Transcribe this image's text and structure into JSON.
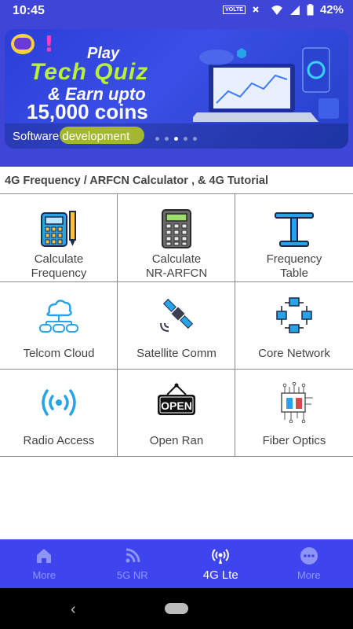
{
  "status_bar": {
    "time": "10:45",
    "volte": "VOLTE",
    "battery": "42%"
  },
  "banner": {
    "play": "Play",
    "tech_quiz": "Tech Quiz",
    "earn": "& Earn upto",
    "coins": "15,000 coins",
    "caption": "Software development",
    "slide_count": 5,
    "active_slide": 3
  },
  "section_title": "4G Frequency / ARFCN Calculator , & 4G Tutorial",
  "grid": [
    {
      "line1": "Calculate",
      "line2": "Frequency",
      "icon": "calculator-pencil-icon"
    },
    {
      "line1": "Calculate",
      "line2": "NR-ARFCN",
      "icon": "calculator-icon"
    },
    {
      "line1": "Frequency",
      "line2": "Table",
      "icon": "table-icon"
    },
    {
      "line1": "Telcom Cloud",
      "line2": "",
      "icon": "cloud-network-icon"
    },
    {
      "line1": "Satellite Comm",
      "line2": "",
      "icon": "satellite-icon"
    },
    {
      "line1": "Core Network",
      "line2": "",
      "icon": "network-nodes-icon"
    },
    {
      "line1": "Radio Access",
      "line2": "",
      "icon": "radio-waves-icon"
    },
    {
      "line1": "Open Ran",
      "line2": "",
      "icon": "open-sign-icon",
      "sign_text": "OPEN"
    },
    {
      "line1": "Fiber Optics",
      "line2": "",
      "icon": "circuit-board-icon"
    }
  ],
  "bottom_nav": [
    {
      "label": "More",
      "icon": "home-icon",
      "active": false
    },
    {
      "label": "5G NR",
      "icon": "rss-icon",
      "active": false
    },
    {
      "label": "4G Lte",
      "icon": "radio-tower-icon",
      "active": true
    },
    {
      "label": "More",
      "icon": "more-dots-icon",
      "active": false
    }
  ],
  "colors": {
    "primary": "#3f45ee",
    "status": "#3f45d6",
    "accent_lime": "#b9f03a",
    "icon_blue": "#29a3e8"
  }
}
